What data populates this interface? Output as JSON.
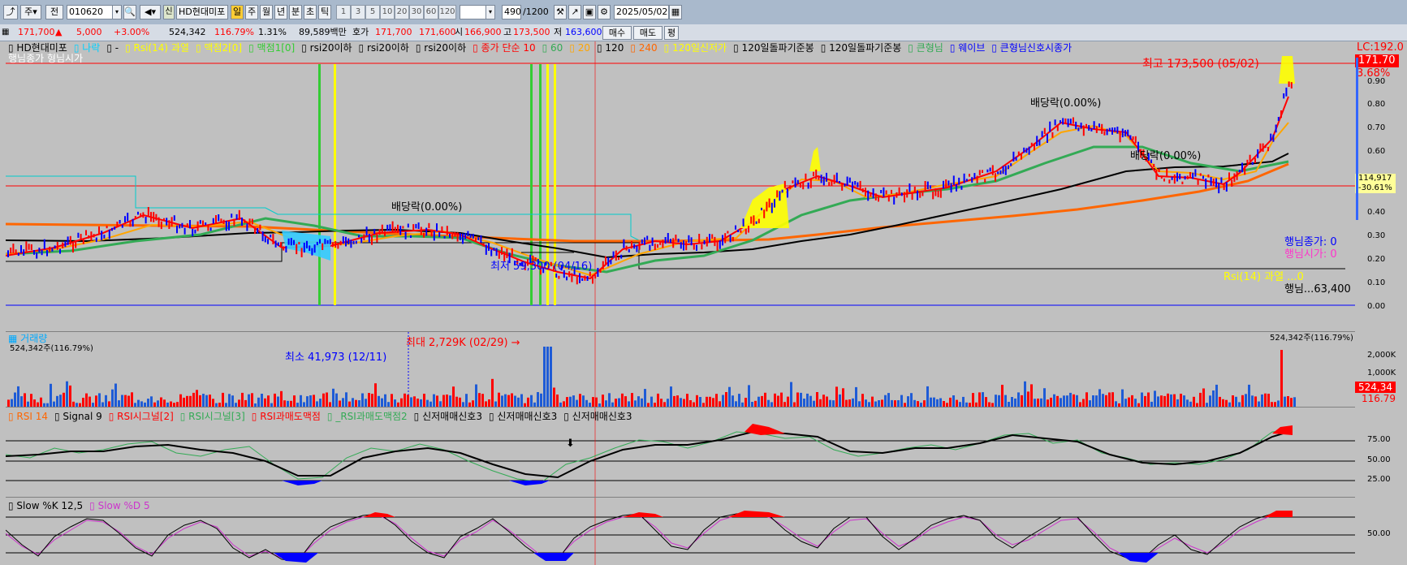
{
  "toolbar": {
    "period": "주",
    "prev_label": "전",
    "code": "010620",
    "stock_name": "HD현대미포",
    "shin": "신",
    "periods": [
      "일",
      "주",
      "월",
      "년",
      "분",
      "초",
      "틱"
    ],
    "active_period": "일",
    "nums": [
      "1",
      "3",
      "5",
      "10",
      "20",
      "30",
      "60",
      "120"
    ],
    "count": "490",
    "count_total": "/1200",
    "date": "2025/05/02"
  },
  "quote": {
    "price": "171,700",
    "arrow": "▲",
    "change": "5,000",
    "change_pct": "+3.00%",
    "volume": "524,342",
    "vol_ratio": "116.79%",
    "turnover": "1.31%",
    "amount": "89,589백만",
    "hoga_label": "호가",
    "ask": "171,700",
    "bid": "171,600",
    "open_label": "시",
    "open": "166,900",
    "high_label": "고",
    "high": "173,500",
    "low_label": "저",
    "low": "163,600",
    "buy": "매수",
    "sell": "매도",
    "eval": "평"
  },
  "price_pane": {
    "legend": [
      {
        "text": "HD현대미포",
        "color": "#000000"
      },
      {
        "text": "나락",
        "color": "#00d0ff"
      },
      {
        "text": "-",
        "color": "#000000"
      },
      {
        "text": "Rsi(14) 과열",
        "color": "#ffff00"
      },
      {
        "text": "맥점2[0]",
        "color": "#ffff00"
      },
      {
        "text": "맥점1[0]",
        "color": "#33cc33"
      },
      {
        "text": "rsi20이하",
        "color": "#000000"
      },
      {
        "text": "rsi20이하",
        "color": "#000000"
      },
      {
        "text": "rsi20이하",
        "color": "#000000"
      },
      {
        "text": "종가 단순 10",
        "color": "#ff0000"
      },
      {
        "text": "60",
        "color": "#33aa55"
      },
      {
        "text": "20",
        "color": "#ffa500"
      },
      {
        "text": "120",
        "color": "#000000"
      },
      {
        "text": "240",
        "color": "#ff6600"
      },
      {
        "text": "120일신저가",
        "color": "#ffff00"
      },
      {
        "text": "120일돌파기준봉",
        "color": "#000000"
      },
      {
        "text": "120일돌파기준봉",
        "color": "#000000"
      },
      {
        "text": "큰형님",
        "color": "#33aa55"
      },
      {
        "text": "웨이브",
        "color": "#0000ff"
      },
      {
        "text": "큰형님신호시종가",
        "color": "#0000ff"
      }
    ],
    "sub_legend": "행님종가 형님시가",
    "annotations": {
      "max": "최고 173,500 (05/02)",
      "min": "최저 59,300 (04/16)",
      "div1": "배당락(0.00%)",
      "div2": "배당락(0.00%)",
      "div3": "배당락(0.00%)",
      "hn_close": "행님종가: 0",
      "hn_open": "행님시가: 0",
      "rsi_over": "Rsi(14) 과열 ...0",
      "hn_bottom": "행님...63,400"
    },
    "scale": [
      "LC:192.0",
      "171.70",
      "3.68%",
      "0.90",
      "0.80",
      "0.70",
      "0.60",
      "114,917",
      "-30.61%",
      "0.40",
      "0.30",
      "0.20",
      "0.10",
      "0.00"
    ]
  },
  "volume_pane": {
    "title": "거래량",
    "sub": "524,342주(116.79%)",
    "sub_right": "524,342주(116.79%)",
    "max": "최대 2,729K (02/29) →",
    "min": "최소 41,973 (12/11)",
    "scale": [
      "2,000K",
      "1,000K",
      "524,34",
      "116.79"
    ]
  },
  "rsi_pane": {
    "legend": [
      {
        "text": "RSI 14",
        "color": "#ff6600"
      },
      {
        "text": "Signal 9",
        "color": "#000000"
      },
      {
        "text": "RSI시그널[2]",
        "color": "#ff0000"
      },
      {
        "text": "RSI시그널[3]",
        "color": "#33aa55"
      },
      {
        "text": "RSI과매도맥점",
        "color": "#ff0000"
      },
      {
        "text": "_RSI과매도맥점2",
        "color": "#33aa55"
      },
      {
        "text": "신저매매신호3",
        "color": "#000000"
      },
      {
        "text": "신저매매신호3",
        "color": "#000000"
      },
      {
        "text": "신저매매신호3",
        "color": "#000000"
      }
    ],
    "scale": [
      "75.00",
      "50.00",
      "25.00"
    ]
  },
  "stoch_pane": {
    "legend": [
      {
        "text": "Slow %K 12,5",
        "color": "#000000"
      },
      {
        "text": "Slow %D 5",
        "color": "#cc33cc"
      }
    ],
    "scale": [
      "50.00"
    ]
  }
}
